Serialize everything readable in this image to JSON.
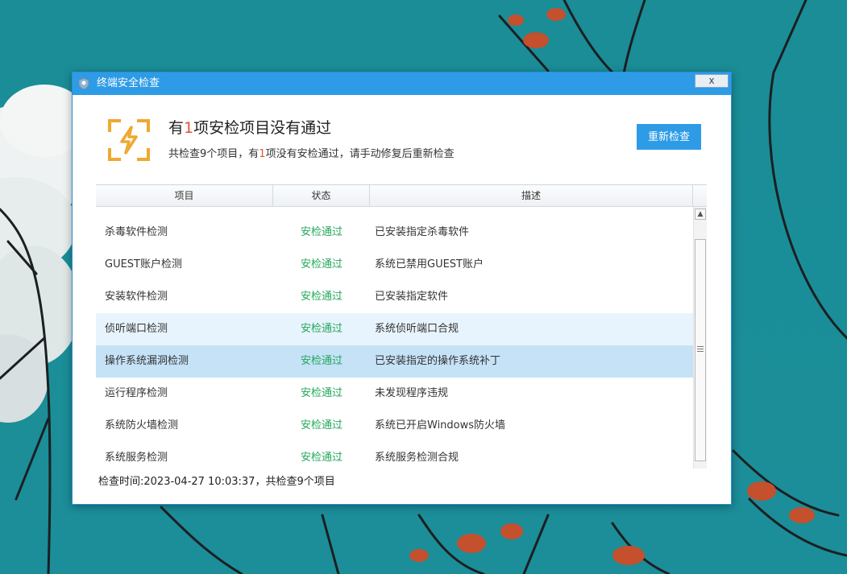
{
  "window": {
    "title": "终端安全检查",
    "close_label": "x",
    "app_icon": "shield-icon"
  },
  "summary": {
    "headline_prefix": "有",
    "headline_count": "1",
    "headline_suffix": "项安检项目没有通过",
    "detail_prefix": "共检查9个项目，有",
    "detail_count": "1",
    "detail_suffix": "项没有安检通过，请手动修复后重新检查",
    "icon": "lightning-alert-icon",
    "icon_color": "#f0a830",
    "warn_color": "#e8512f"
  },
  "actions": {
    "recheck_label": "重新检查"
  },
  "table": {
    "columns": [
      "项目",
      "状态",
      "描述"
    ],
    "rows": [
      {
        "name": "杀毒软件检测",
        "status": "安检通过",
        "desc": "已安装指定杀毒软件"
      },
      {
        "name": "GUEST账户检测",
        "status": "安检通过",
        "desc": "系统已禁用GUEST账户"
      },
      {
        "name": "安装软件检测",
        "status": "安检通过",
        "desc": "已安装指定软件"
      },
      {
        "name": "侦听端口检测",
        "status": "安检通过",
        "desc": "系统侦听端口合规"
      },
      {
        "name": "操作系统漏洞检测",
        "status": "安检通过",
        "desc": "已安装指定的操作系统补丁"
      },
      {
        "name": "运行程序检测",
        "status": "安检通过",
        "desc": "未发现程序违规"
      },
      {
        "name": "系统防火墙检测",
        "status": "安检通过",
        "desc": "系统已开启Windows防火墙"
      },
      {
        "name": "系统服务检测",
        "status": "安检通过",
        "desc": "系统服务检测合规"
      }
    ],
    "hover_row": 3,
    "selected_row": 4,
    "status_color": "#22a85a"
  },
  "footer": {
    "text": "检查时间:2023-04-27 10:03:37，共检查9个项目"
  }
}
